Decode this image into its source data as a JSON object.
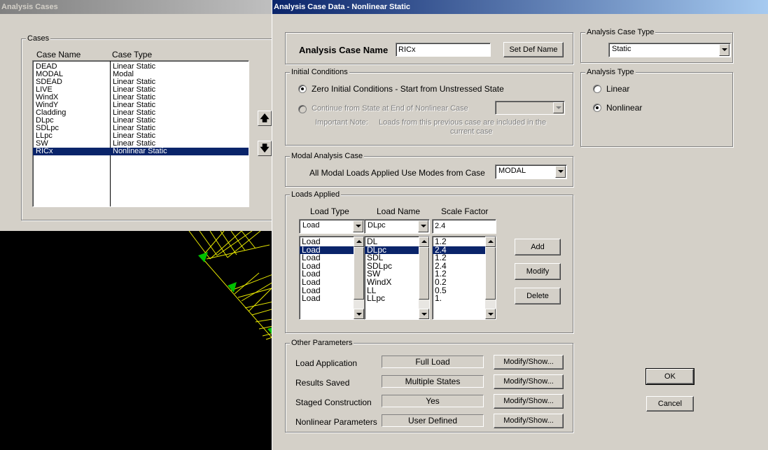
{
  "analysis_cases": {
    "title": "Analysis Cases",
    "cases_group": "Cases",
    "col_name": "Case Name",
    "col_type": "Case Type",
    "rows": [
      {
        "name": "DEAD",
        "type": "Linear Static"
      },
      {
        "name": "MODAL",
        "type": "Modal"
      },
      {
        "name": "SDEAD",
        "type": "Linear Static"
      },
      {
        "name": "LIVE",
        "type": "Linear Static"
      },
      {
        "name": "WindX",
        "type": "Linear Static"
      },
      {
        "name": "WindY",
        "type": "Linear Static"
      },
      {
        "name": "Cladding",
        "type": "Linear Static"
      },
      {
        "name": "DLpc",
        "type": "Linear Static"
      },
      {
        "name": "SDLpc",
        "type": "Linear Static"
      },
      {
        "name": "LLpc",
        "type": "Linear Static"
      },
      {
        "name": "SW",
        "type": "Linear Static"
      },
      {
        "name": "RICx",
        "type": "Nonlinear Static"
      }
    ],
    "selected_row": "RICx",
    "move_up_icon": "arrow-up-icon",
    "move_down_icon": "arrow-down-icon"
  },
  "dialog": {
    "title": "Analysis Case Data - Nonlinear Static",
    "case_name_label": "Analysis Case Name",
    "case_name_value": "RICx",
    "set_def_name": "Set Def Name",
    "initial_conditions": {
      "group": "Initial Conditions",
      "zero_label": "Zero Initial Conditions - Start from Unstressed State",
      "continue_label": "Continue from State at End of Nonlinear Case",
      "important_note": "Important Note:",
      "note_line1": "Loads from this previous case are included in the",
      "note_line2": "current case",
      "selected": "zero"
    },
    "case_type": {
      "group": "Analysis Case Type",
      "value": "Static"
    },
    "analysis_type": {
      "group": "Analysis Type",
      "linear": "Linear",
      "nonlinear": "Nonlinear",
      "selected": "nonlinear"
    },
    "modal": {
      "group": "Modal Analysis Case",
      "label": "All Modal Loads Applied Use Modes from Case",
      "value": "MODAL"
    },
    "loads": {
      "group": "Loads Applied",
      "col_type": "Load Type",
      "col_name": "Load Name",
      "col_scale": "Scale Factor",
      "edit_type": "Load",
      "edit_name": "DLpc",
      "edit_scale": "2.4",
      "types": [
        "Load",
        "Load",
        "Load",
        "Load",
        "Load",
        "Load",
        "Load",
        "Load"
      ],
      "names": [
        "DL",
        "DLpc",
        "SDL",
        "SDLpc",
        "SW",
        "WindX",
        "LL",
        "LLpc"
      ],
      "scales": [
        "1.2",
        "2.4",
        "1.2",
        "2.4",
        "1.2",
        "0.2",
        "0.5",
        "1."
      ],
      "selected_index": 1,
      "add": "Add",
      "modify": "Modify",
      "delete": "Delete"
    },
    "other": {
      "group": "Other Parameters",
      "rows": [
        {
          "label": "Load Application",
          "value": "Full Load",
          "button": "Modify/Show..."
        },
        {
          "label": "Results Saved",
          "value": "Multiple States",
          "button": "Modify/Show..."
        },
        {
          "label": "Staged Construction",
          "value": "Yes",
          "button": "Modify/Show..."
        },
        {
          "label": "Nonlinear Parameters",
          "value": "User Defined",
          "button": "Modify/Show..."
        }
      ]
    },
    "ok": "OK",
    "cancel": "Cancel"
  }
}
